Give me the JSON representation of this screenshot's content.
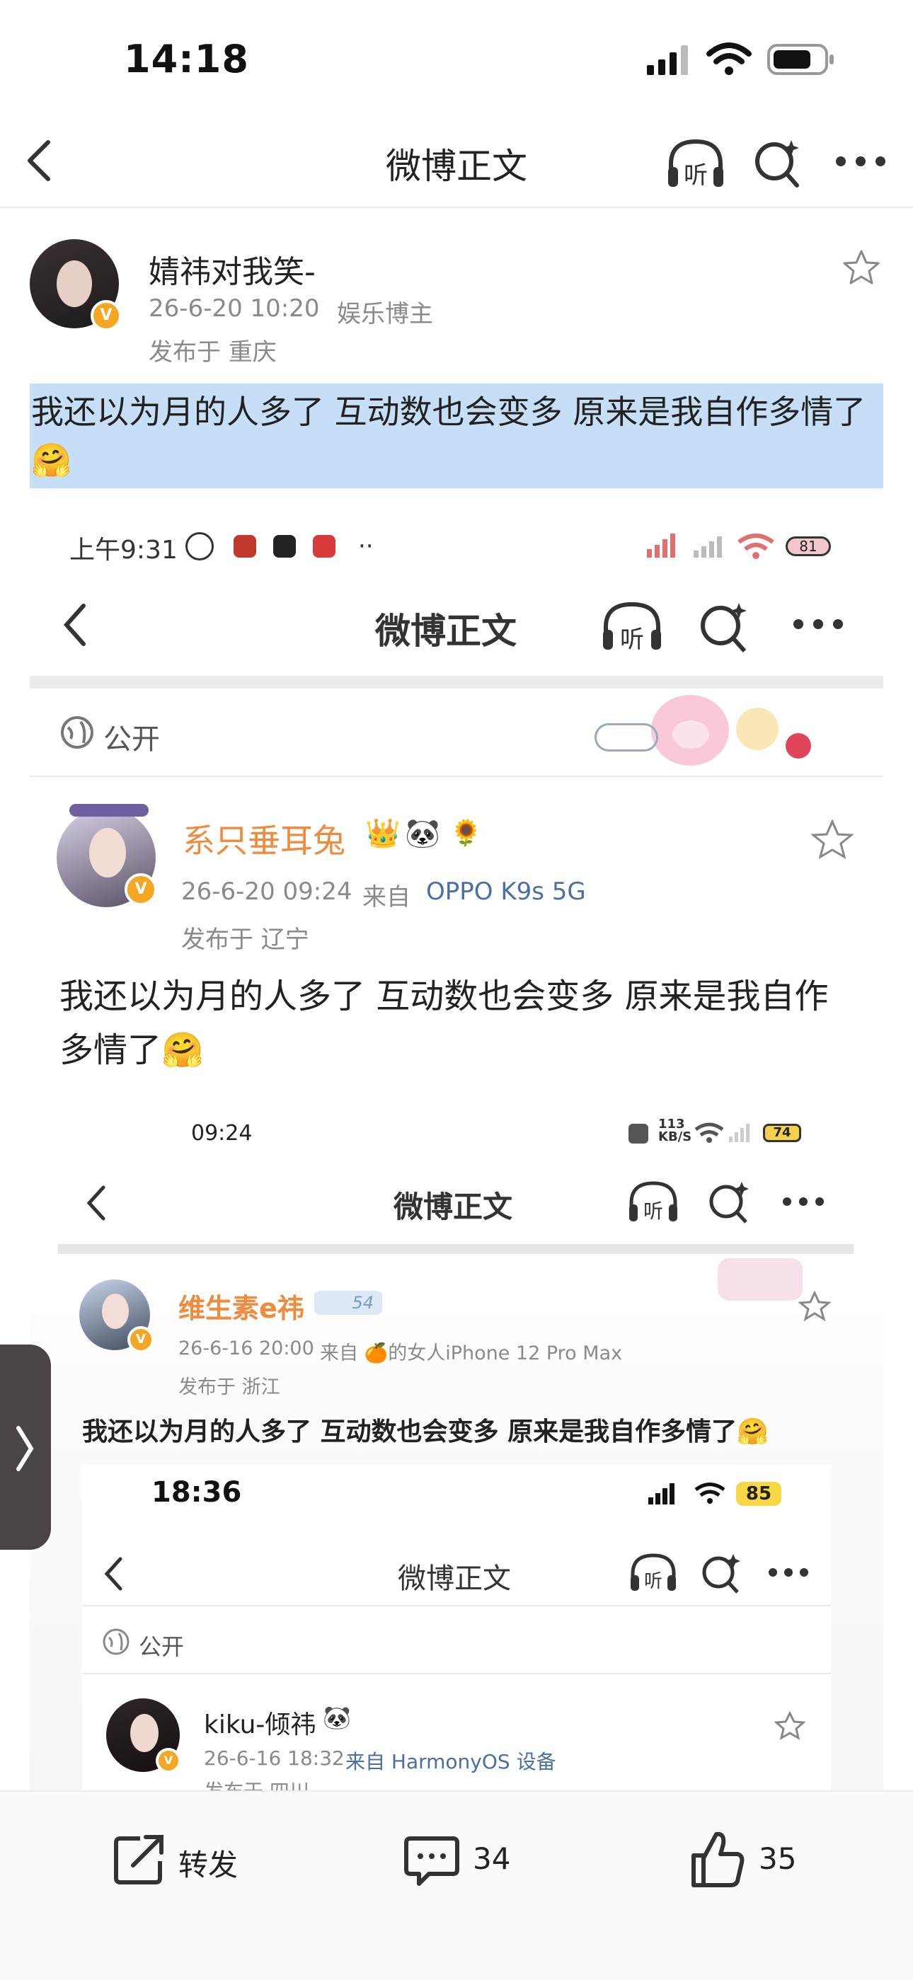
{
  "status_bar": {
    "time": "14:18"
  },
  "nav": {
    "title": "微博正文",
    "listen_label": "听"
  },
  "post": {
    "author": "婧祎对我笑-",
    "date": "26-6-20 10:20",
    "tag": "娱乐博主",
    "location": "发布于 重庆",
    "text": "我还以为月的人多了 互动数也会变多 原来是我自作多情了🤗"
  },
  "shot1": {
    "time": "上午9:31",
    "battery": "81",
    "title": "微博正文",
    "listen_label": "听",
    "visibility": "公开",
    "author": "系只垂耳兔",
    "date": "26-6-20 09:24",
    "source_prefix": "来自",
    "source": "OPPO K9s 5G",
    "location": "发布于 辽宁",
    "text": "我还以为月的人多了 互动数也会变多 原来是我自作多情了🤗"
  },
  "shot2": {
    "time": "09:24",
    "speed": "113",
    "speed_unit": "KB/S",
    "battery": "74",
    "title": "微博正文",
    "listen_label": "听",
    "author": "维生素e祎",
    "level": "54",
    "date": "26-6-16 20:00",
    "source": "来自 🍊的女人iPhone 12 Pro Max",
    "location": "发布于 浙江",
    "text": "我还以为月的人多了 互动数也会变多 原来是我自作多情了🤗"
  },
  "shot3": {
    "time": "18:36",
    "battery": "85",
    "title": "微博正文",
    "listen_label": "听",
    "visibility": "公开",
    "author": "kiku-倾祎",
    "date": "26-6-16 18:32",
    "source": "来自 HarmonyOS 设备",
    "location": "发布于 四川"
  },
  "actions": {
    "repost_label": "转发",
    "comment_count": "34",
    "like_count": "35"
  },
  "colors": {
    "highlight": "#c6dff6",
    "accent_orange": "#f08a3c",
    "verified": "#f5a623"
  }
}
